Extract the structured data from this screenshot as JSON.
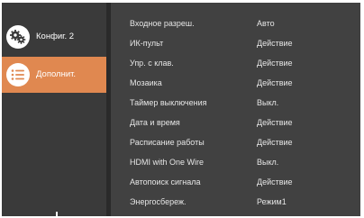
{
  "sidebar": {
    "items": [
      {
        "label": "Конфиг. 2",
        "icon": "gear-cog-icon",
        "active": false
      },
      {
        "label": "Дополнит.",
        "icon": "list-icon",
        "active": true
      }
    ]
  },
  "settings": {
    "rows": [
      {
        "name": "Входное разреш.",
        "value": "Авто"
      },
      {
        "name": "ИК-пульт",
        "value": "Действие"
      },
      {
        "name": "Упр. с клав.",
        "value": "Действие"
      },
      {
        "name": "Мозаика",
        "value": "Действие"
      },
      {
        "name": "Таймер выключения",
        "value": "Выкл."
      },
      {
        "name": "Дата и время",
        "value": "Действие"
      },
      {
        "name": "Расписание работы",
        "value": "Действие"
      },
      {
        "name": "HDMI with One Wire",
        "value": "Выкл."
      },
      {
        "name": "Автопоиск сигнала",
        "value": "Действие"
      },
      {
        "name": "Энергосбереж.",
        "value": "Режим1"
      }
    ]
  },
  "colors": {
    "sidebar_bg": "#3a3a3a",
    "content_bg": "#414141",
    "active_accent": "#e08850",
    "text": "#e6e6e6"
  }
}
